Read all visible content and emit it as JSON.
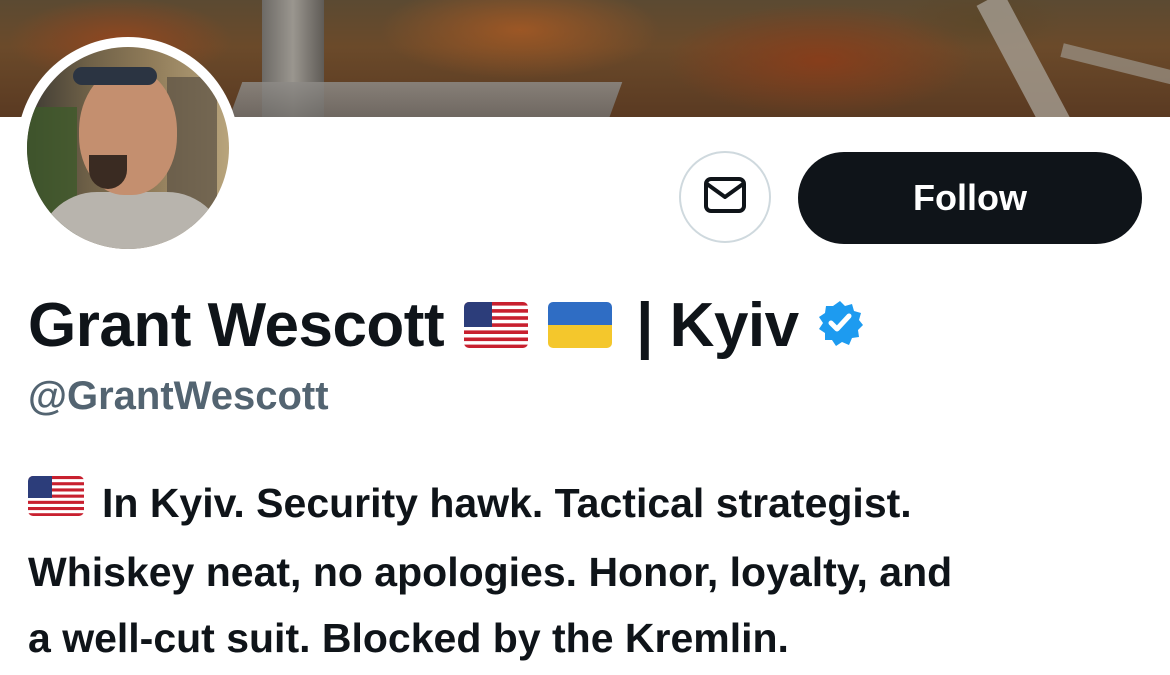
{
  "profile": {
    "display_name": "Grant Wescott",
    "name_suffix": "| Kyiv",
    "handle": "@GrantWescott",
    "flags": [
      "us-flag",
      "ukraine-flag"
    ],
    "verified": true
  },
  "actions": {
    "message_icon": "envelope-icon",
    "follow_label": "Follow"
  },
  "bio": {
    "flag": "us-flag",
    "lines": [
      "In Kyiv. Security hawk. Tactical strategist.",
      "Whiskey neat, no apologies. Honor, loyalty, and",
      "a well-cut suit. Blocked by the Kremlin."
    ]
  },
  "colors": {
    "text_primary": "#0f1419",
    "text_secondary": "#536471",
    "verified_blue": "#1d9bf0",
    "follow_bg": "#0f1419",
    "border": "#cfd9de"
  }
}
